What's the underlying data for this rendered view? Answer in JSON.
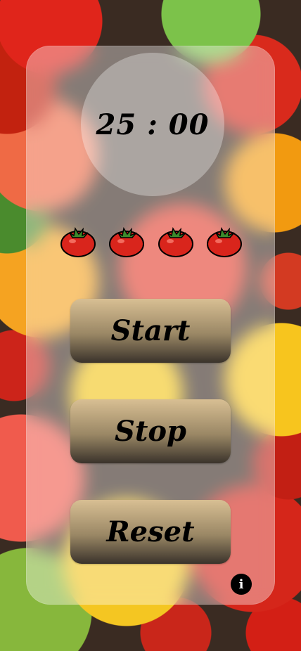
{
  "timer": {
    "display": "25 : 00"
  },
  "pomodoros": {
    "count": 4,
    "icon": "tomato-icon"
  },
  "buttons": {
    "start_label": "Start",
    "stop_label": "Stop",
    "reset_label": "Reset"
  },
  "info": {
    "glyph": "i"
  },
  "colors": {
    "panel": "#ffffff",
    "button_top": "#d8bf93",
    "button_bottom": "#3a332b",
    "tomato_red": "#d9251c",
    "stem_green": "#3c8a2c"
  }
}
